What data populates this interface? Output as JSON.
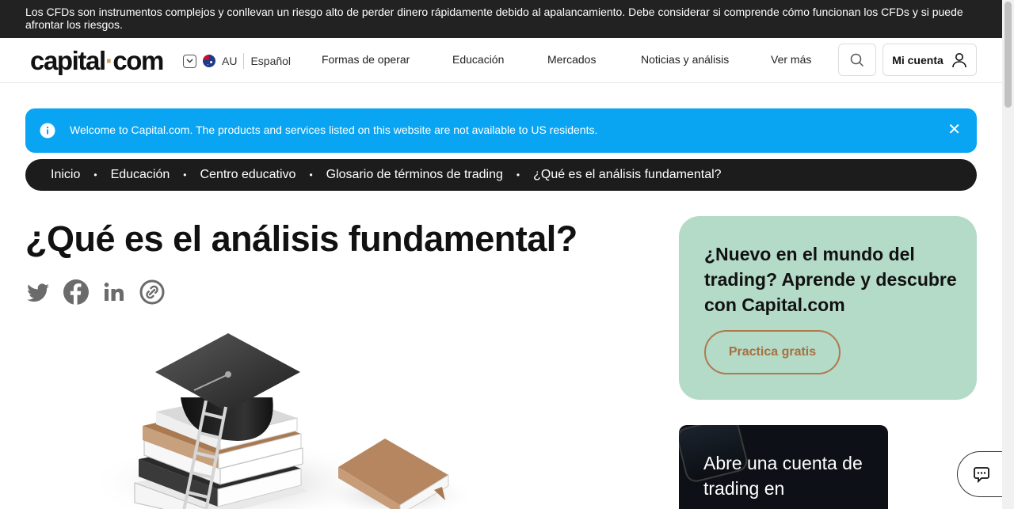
{
  "risk_warning": "Los CFDs son instrumentos complejos y conllevan un riesgo alto de perder dinero rápidamente debido al apalancamiento. Debe considerar si comprende cómo funcionan los CFDs y si puede afrontar los riesgos.",
  "header": {
    "logo_text": "capital",
    "logo_dot": "·",
    "logo_suffix": "com",
    "region": "AU",
    "language": "Español",
    "menu": [
      "Formas de operar",
      "Educación",
      "Mercados",
      "Noticias y análisis",
      "Ver más"
    ],
    "account_label": "Mi cuenta"
  },
  "banner": {
    "message": "Welcome to Capital.com. The products and services listed on this website are not available to US residents.",
    "close": "✕"
  },
  "breadcrumbs": [
    "Inicio",
    "Educación",
    "Centro educativo",
    "Glosario de términos de trading",
    "¿Qué es el análisis fundamental?"
  ],
  "breadcrumb_separator": "•",
  "page_title": "¿Qué es el análisis fundamental?",
  "share_icons": [
    "twitter-icon",
    "facebook-icon",
    "linkedin-icon",
    "copy-link-icon"
  ],
  "promo": {
    "title": "¿Nuevo en el mundo del trading? Aprende y descubre con Capital.com",
    "button": "Practica gratis"
  },
  "app_card": {
    "text": "Abre una cuenta de trading en"
  },
  "colors": {
    "banner": "#0aa5f2",
    "promo_bg": "#b4dac8",
    "promo_button": "#a8703e",
    "logo_dot": "#c9a26b",
    "dark": "#1c1c1c"
  }
}
